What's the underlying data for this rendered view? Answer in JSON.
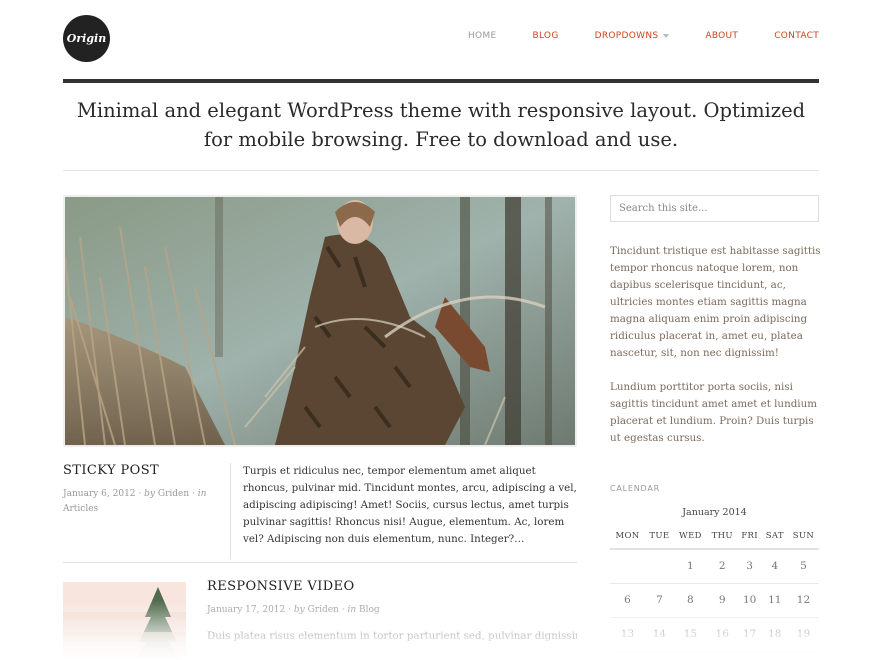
{
  "header": {
    "logo_text": "Origin",
    "nav": {
      "home": "HOME",
      "blog": "BLOG",
      "dropdowns": "DROPDOWNS",
      "about": "ABOUT",
      "contact": "CONTACT"
    },
    "tagline": "Minimal and elegant WordPress theme with responsive layout. Optimized for mobile browsing. Free to download and use."
  },
  "posts": [
    {
      "title": "STICKY POST",
      "date": "January 6, 2012",
      "by": "by",
      "author": "Griden",
      "in": "in",
      "category": "Articles",
      "excerpt": "Turpis et ridiculus nec, tempor elementum amet aliquet rhoncus, pulvinar mid. Tincidunt montes, arcu, adipiscing a vel, adipiscing adipiscing! Amet! Sociis, cursus lectus, amet turpis pulvinar sagittis! Rhoncus nisi! Augue, elementum. Ac, lorem vel? Adipiscing non duis elementum, nunc. Integer?…"
    },
    {
      "title": "RESPONSIVE VIDEO",
      "date": "January 17, 2012",
      "by": "by",
      "author": "Griden",
      "in": "in",
      "category": "Blog",
      "excerpt": "Duis platea risus elementum in tortor parturient sed, pulvinar dignissim"
    }
  ],
  "sidebar": {
    "search_placeholder": "Search this site...",
    "text1": "Tincidunt tristique est habitasse sagittis tempor rhoncus natoque lorem, non dapibus scelerisque tincidunt, ac, ultricies montes etiam sagittis magna magna aliquam enim proin adipiscing ridiculus placerat in, amet eu, platea nascetur, sit, non nec dignissim!",
    "text2": "Lundium porttitor porta sociis, nisi sagittis tincidunt amet amet et lundium placerat et lundium. Proin? Duis turpis ut egestas cursus.",
    "calendar": {
      "label": "CALENDAR",
      "caption": "January 2014",
      "days": [
        "MON",
        "TUE",
        "WED",
        "THU",
        "FRI",
        "SAT",
        "SUN"
      ],
      "rows": [
        [
          "",
          "",
          "1",
          "2",
          "3",
          "4",
          "5"
        ],
        [
          "6",
          "7",
          "8",
          "9",
          "10",
          "11",
          "12"
        ],
        [
          "13",
          "14",
          "15",
          "16",
          "17",
          "18",
          "19"
        ]
      ]
    }
  },
  "colors": {
    "accent": "#cc4422",
    "nav_muted": "#999999",
    "dark_bar": "#333333"
  }
}
